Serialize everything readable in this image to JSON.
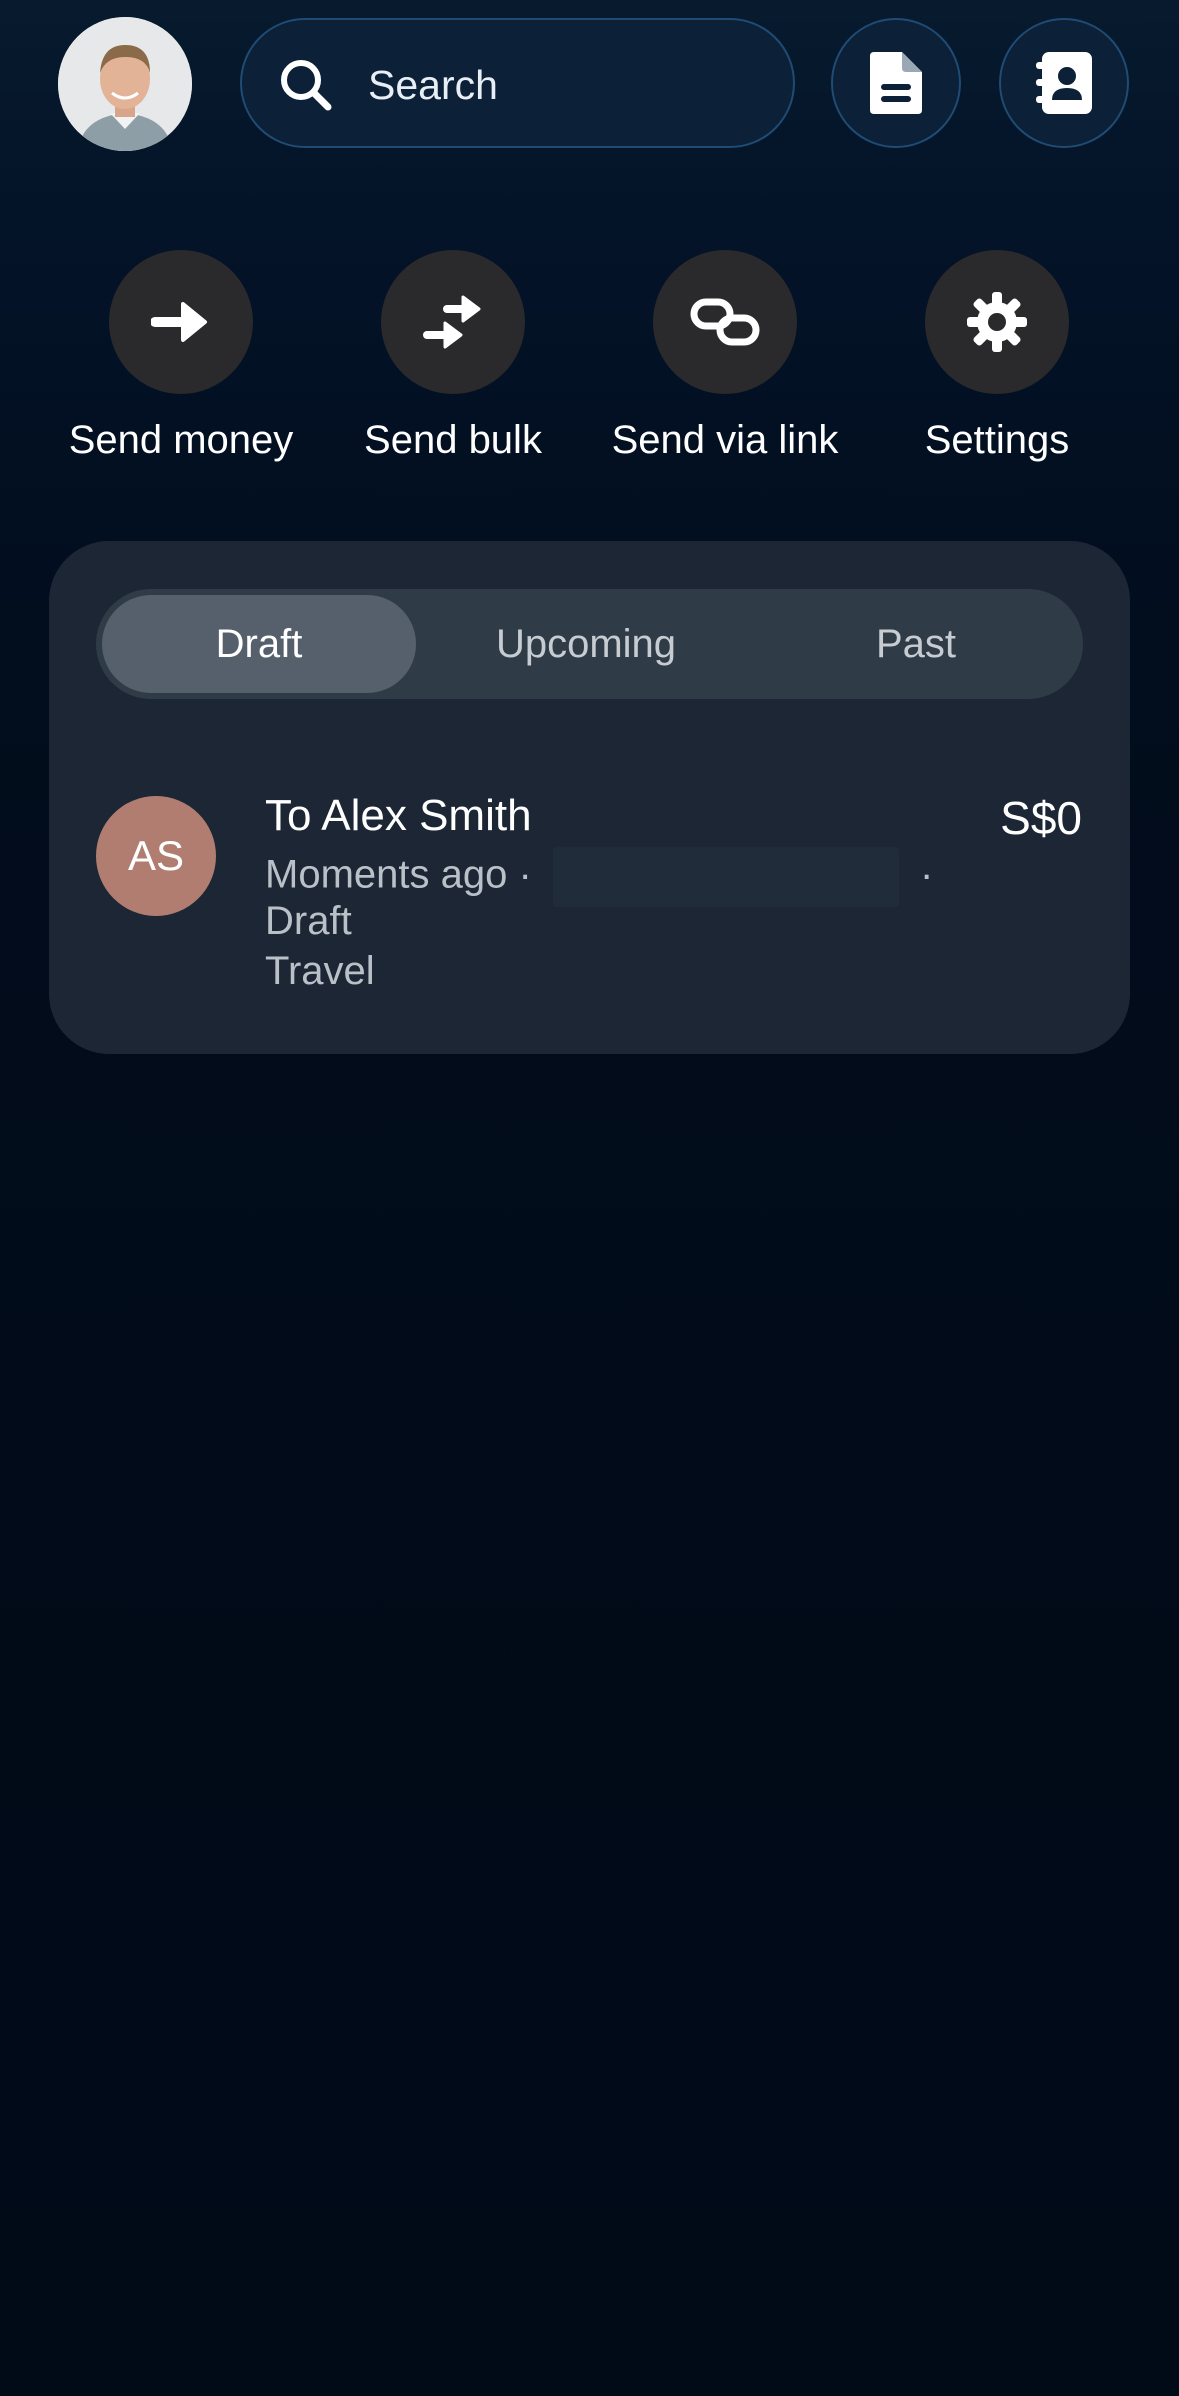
{
  "header": {
    "avatar": {
      "icon": "profile-photo",
      "alt": ""
    },
    "search": {
      "placeholder": "Search",
      "icon": "search-icon"
    },
    "buttons": [
      {
        "icon": "document-icon"
      },
      {
        "icon": "contacts-icon"
      }
    ]
  },
  "actions": [
    {
      "label": "Send money",
      "icon": "arrow-right-icon"
    },
    {
      "label": "Send bulk",
      "icon": "swap-arrows-icon"
    },
    {
      "label": "Send via link",
      "icon": "link-icon"
    },
    {
      "label": "Settings",
      "icon": "gear-icon"
    }
  ],
  "tabs": {
    "items": [
      "Draft",
      "Upcoming",
      "Past"
    ],
    "active": "Draft"
  },
  "transactions": [
    {
      "initials": "AS",
      "title": "To Alex Smith",
      "amount": "S$0",
      "time": "Moments ago",
      "separator": "·",
      "status": "Draft",
      "category": "Travel"
    }
  ],
  "colors": {
    "background": "#010b19",
    "card": "#1c2634",
    "segment": "#303b48",
    "segment_active": "#56606c",
    "action_circle": "#2a2a2c",
    "initials_avatar": "#b07d70",
    "accent_border": "#1f4b74"
  }
}
